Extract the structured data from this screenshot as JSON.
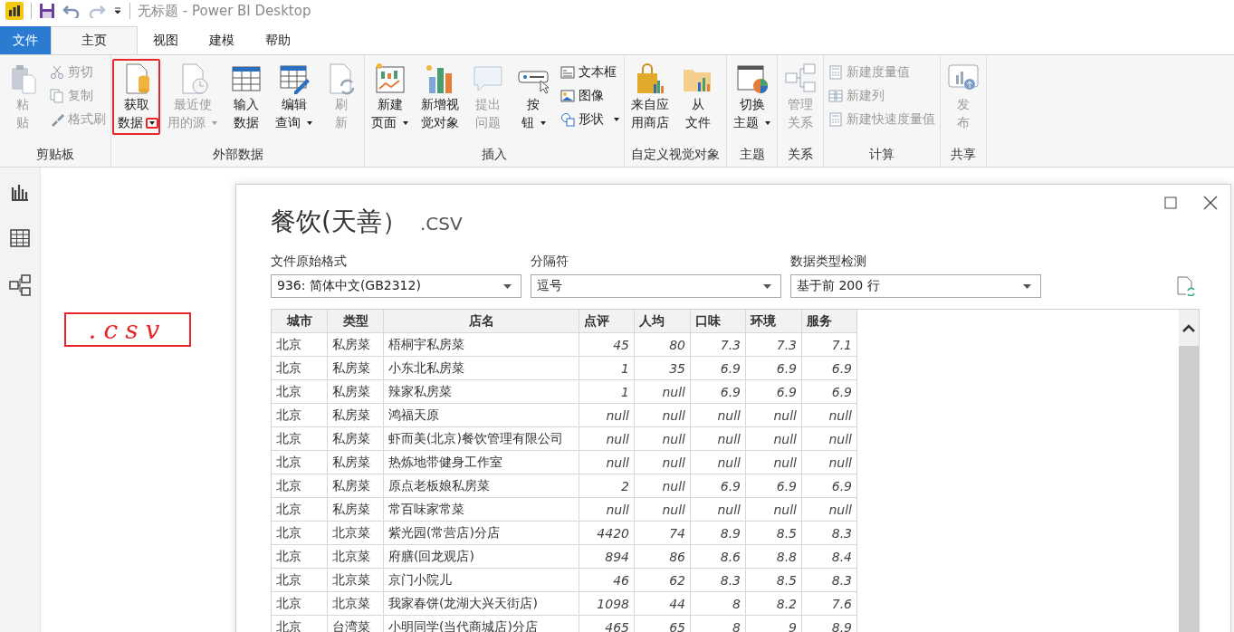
{
  "title_bar": {
    "title": "无标题 - Power BI Desktop"
  },
  "ribbon_tabs": [
    {
      "label": "文件",
      "kind": "file",
      "selected": false
    },
    {
      "label": "主页",
      "kind": "tab",
      "selected": true
    },
    {
      "label": "视图",
      "kind": "tab",
      "selected": false
    },
    {
      "label": "建模",
      "kind": "tab",
      "selected": false
    },
    {
      "label": "帮助",
      "kind": "tab",
      "selected": false
    }
  ],
  "ribbon_groups": [
    {
      "label": "剪贴板",
      "items": [
        {
          "kind": "large",
          "lines": [
            "粘",
            "贴"
          ],
          "dropdown": false,
          "disabled": true
        },
        {
          "kind": "stack",
          "items": [
            {
              "label": "剪切",
              "dropdown": false,
              "disabled": true
            },
            {
              "label": "复制",
              "dropdown": false,
              "disabled": true
            },
            {
              "label": "格式刷",
              "dropdown": false,
              "disabled": true
            }
          ]
        }
      ]
    },
    {
      "label": "外部数据",
      "items": [
        {
          "kind": "large",
          "lines": [
            "获取",
            "数据"
          ],
          "dropdown": true,
          "disabled": false
        },
        {
          "kind": "large",
          "lines": [
            "最近使",
            "用的源"
          ],
          "dropdown": true,
          "disabled": true
        },
        {
          "kind": "large",
          "lines": [
            "输入",
            "数据"
          ],
          "dropdown": false,
          "disabled": false
        },
        {
          "kind": "large",
          "lines": [
            "编辑",
            "查询"
          ],
          "dropdown": true,
          "disabled": false
        },
        {
          "kind": "large",
          "lines": [
            "刷",
            "新"
          ],
          "dropdown": false,
          "disabled": true
        }
      ]
    },
    {
      "label": "插入",
      "items": [
        {
          "kind": "large",
          "lines": [
            "新建",
            "页面"
          ],
          "dropdown": true,
          "disabled": false
        },
        {
          "kind": "large",
          "lines": [
            "新增视",
            "觉对象"
          ],
          "dropdown": false,
          "disabled": false
        },
        {
          "kind": "large",
          "lines": [
            "提出",
            "问题"
          ],
          "dropdown": false,
          "disabled": true
        },
        {
          "kind": "large",
          "lines": [
            "按",
            "钮"
          ],
          "dropdown": true,
          "disabled": false
        },
        {
          "kind": "stack",
          "items": [
            {
              "label": "文本框",
              "dropdown": false,
              "disabled": false
            },
            {
              "label": "图像",
              "dropdown": false,
              "disabled": false
            },
            {
              "label": "形状",
              "dropdown": true,
              "disabled": false
            }
          ]
        }
      ]
    },
    {
      "label": "自定义视觉对象",
      "items": [
        {
          "kind": "large",
          "lines": [
            "来自应",
            "用商店"
          ],
          "dropdown": false,
          "disabled": false
        },
        {
          "kind": "large",
          "lines": [
            "从",
            "文件"
          ],
          "dropdown": false,
          "disabled": false
        }
      ]
    },
    {
      "label": "主题",
      "items": [
        {
          "kind": "large",
          "lines": [
            "切换",
            "主题"
          ],
          "dropdown": true,
          "disabled": false
        }
      ]
    },
    {
      "label": "关系",
      "items": [
        {
          "kind": "large",
          "lines": [
            "管理",
            "关系"
          ],
          "dropdown": false,
          "disabled": true
        }
      ]
    },
    {
      "label": "计算",
      "items": [
        {
          "kind": "stack",
          "items": [
            {
              "label": "新建度量值",
              "dropdown": false,
              "disabled": true
            },
            {
              "label": "新建列",
              "dropdown": false,
              "disabled": true
            },
            {
              "label": "新建快速度量值",
              "dropdown": false,
              "disabled": true
            }
          ]
        }
      ]
    },
    {
      "label": "共享",
      "items": [
        {
          "kind": "large",
          "lines": [
            "发",
            "布"
          ],
          "dropdown": false,
          "disabled": true
        }
      ]
    }
  ],
  "annotations": [
    {
      "kind": "box"
    },
    {
      "kind": "box"
    },
    {
      "kind": "handwriting",
      "text": ".csv"
    }
  ],
  "dialog": {
    "title": "餐饮(天善）",
    "extension": ".CSV",
    "fields": [
      {
        "label": "文件原始格式",
        "value": "936: 简体中文(GB2312)"
      },
      {
        "label": "分隔符",
        "value": "逗号"
      },
      {
        "label": "数据类型检测",
        "value": "基于前 200 行"
      }
    ],
    "table": {
      "columns": [
        {
          "label": "城市",
          "kind": "text"
        },
        {
          "label": "类型",
          "kind": "text"
        },
        {
          "label": "店名",
          "kind": "text"
        },
        {
          "label": "点评",
          "kind": "number"
        },
        {
          "label": "人均",
          "kind": "number"
        },
        {
          "label": "口味",
          "kind": "number"
        },
        {
          "label": "环境",
          "kind": "number"
        },
        {
          "label": "服务",
          "kind": "number"
        }
      ],
      "rows": [
        [
          "北京",
          "私房菜",
          "梧桐宇私房菜",
          "45",
          "80",
          "7.3",
          "7.3",
          "7.1"
        ],
        [
          "北京",
          "私房菜",
          "小东北私房菜",
          "1",
          "35",
          "6.9",
          "6.9",
          "6.9"
        ],
        [
          "北京",
          "私房菜",
          "辣家私房菜",
          "1",
          "null",
          "6.9",
          "6.9",
          "6.9"
        ],
        [
          "北京",
          "私房菜",
          "鸿福天原",
          "null",
          "null",
          "null",
          "null",
          "null"
        ],
        [
          "北京",
          "私房菜",
          "虾而美(北京)餐饮管理有限公司",
          "null",
          "null",
          "null",
          "null",
          "null"
        ],
        [
          "北京",
          "私房菜",
          "热炼地带健身工作室",
          "null",
          "null",
          "null",
          "null",
          "null"
        ],
        [
          "北京",
          "私房菜",
          "原点老板娘私房菜",
          "2",
          "null",
          "6.9",
          "6.9",
          "6.9"
        ],
        [
          "北京",
          "私房菜",
          "常百味家常菜",
          "null",
          "null",
          "null",
          "null",
          "null"
        ],
        [
          "北京",
          "北京菜",
          "紫光园(常营店)分店",
          "4420",
          "74",
          "8.9",
          "8.5",
          "8.3"
        ],
        [
          "北京",
          "北京菜",
          "府膳(回龙观店)",
          "894",
          "86",
          "8.6",
          "8.8",
          "8.4"
        ],
        [
          "北京",
          "北京菜",
          "京门小院儿",
          "46",
          "62",
          "8.3",
          "8.5",
          "8.3"
        ],
        [
          "北京",
          "北京菜",
          "我家春饼(龙湖大兴天街店)",
          "1098",
          "44",
          "8",
          "8.2",
          "7.6"
        ],
        [
          "北京",
          "台湾菜",
          "小明同学(当代商城店)分店",
          "465",
          "65",
          "8",
          "9",
          "8.9"
        ]
      ]
    }
  }
}
